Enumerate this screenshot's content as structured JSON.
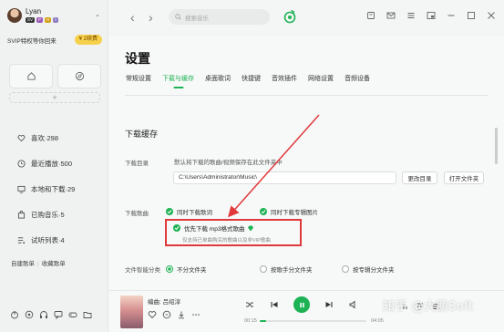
{
  "user": {
    "name": "Lyan",
    "badges": [
      "SV",
      "P",
      "H",
      "Ⅰ"
    ]
  },
  "vip": {
    "text": "SVIP特权等你回来",
    "pill": "¥ 2续费"
  },
  "sidebar": {
    "items": [
      {
        "icon": "heart-icon",
        "label": "喜欢·298"
      },
      {
        "icon": "clock-icon",
        "label": "最近播放·500"
      },
      {
        "icon": "computer-icon",
        "label": "本地和下载·29"
      },
      {
        "icon": "bag-icon",
        "label": "已购音乐·5"
      },
      {
        "icon": "list-icon",
        "label": "试听列表·4"
      }
    ],
    "tab_created": "自建歌单",
    "tab_collected": "收藏歌单"
  },
  "topbar": {
    "search_placeholder": "搜索音乐"
  },
  "settings": {
    "title": "设置",
    "tabs": [
      "常规设置",
      "下载与缓存",
      "桌面歌词",
      "快捷键",
      "音效插件",
      "网络设置",
      "音频设备"
    ],
    "active_tab": 1,
    "section_title": "下载缓存",
    "download_dir": {
      "label": "下载目录",
      "desc": "默认将下载的歌曲/视频保存在此文件夹中",
      "path": "C:\\Users\\Administrator\\Music\\",
      "change_btn": "更改目录",
      "open_btn": "打开文件夹"
    },
    "download_song": {
      "label": "下载歌曲",
      "opt_lyrics": "同时下载歌词",
      "opt_cover": "同时下载专辑图片",
      "opt_mp3": "优先下载 mp3格式歌曲",
      "opt_mp3_sub": "仅支持已单曲购买的歌曲以及非VIP歌曲"
    },
    "smart_sort": {
      "label": "文件智能分类",
      "opt_none": "不分文件夹",
      "opt_singer": "按歌手分文件夹",
      "opt_album": "按专辑分文件夹"
    }
  },
  "player": {
    "song": "编曲: 吕绍淳",
    "time_current": "00:15",
    "time_total": "04:05",
    "progress": 0.06
  },
  "watermark": "知乎 @大鹏Soft",
  "colors": {
    "accent": "#1db354",
    "annotation": "#e0393b",
    "vip": "#f7d14b"
  }
}
